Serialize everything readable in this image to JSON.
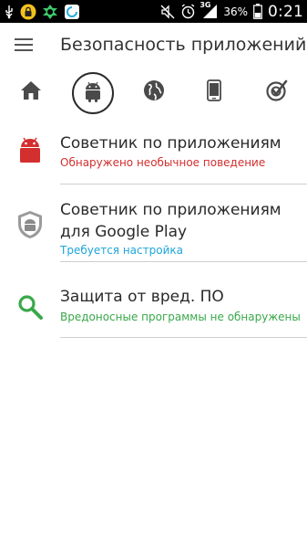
{
  "status_bar": {
    "battery": "36%",
    "time": "0:21",
    "network": "3G"
  },
  "app": {
    "title": "Безопасность приложений"
  },
  "tabs": [
    {
      "icon": "home-icon"
    },
    {
      "icon": "android-icon",
      "active": true
    },
    {
      "icon": "globe-icon"
    },
    {
      "icon": "phone-icon"
    },
    {
      "icon": "check-target-icon"
    }
  ],
  "items": [
    {
      "title": "Советник по приложениям",
      "subtitle": "Обнаружено необычное поведение",
      "subtitle_color": "#d32f2f",
      "icon": "android-alert-icon"
    },
    {
      "title_line1": "Советник по приложениям",
      "title_line2": "для Google Play",
      "subtitle": "Требуется настройка",
      "subtitle_color": "#1ea5d8",
      "icon": "shield-android-icon"
    },
    {
      "title": "Защита от вред. ПО",
      "subtitle": "Вредоносные программы не обнаружены",
      "subtitle_color": "#3aa84a",
      "icon": "magnifier-icon"
    }
  ],
  "colors": {
    "accent_red": "#d32f2f",
    "accent_blue": "#1ea5d8",
    "accent_green": "#3aa84a",
    "icon_dark": "#4a4a4a"
  }
}
